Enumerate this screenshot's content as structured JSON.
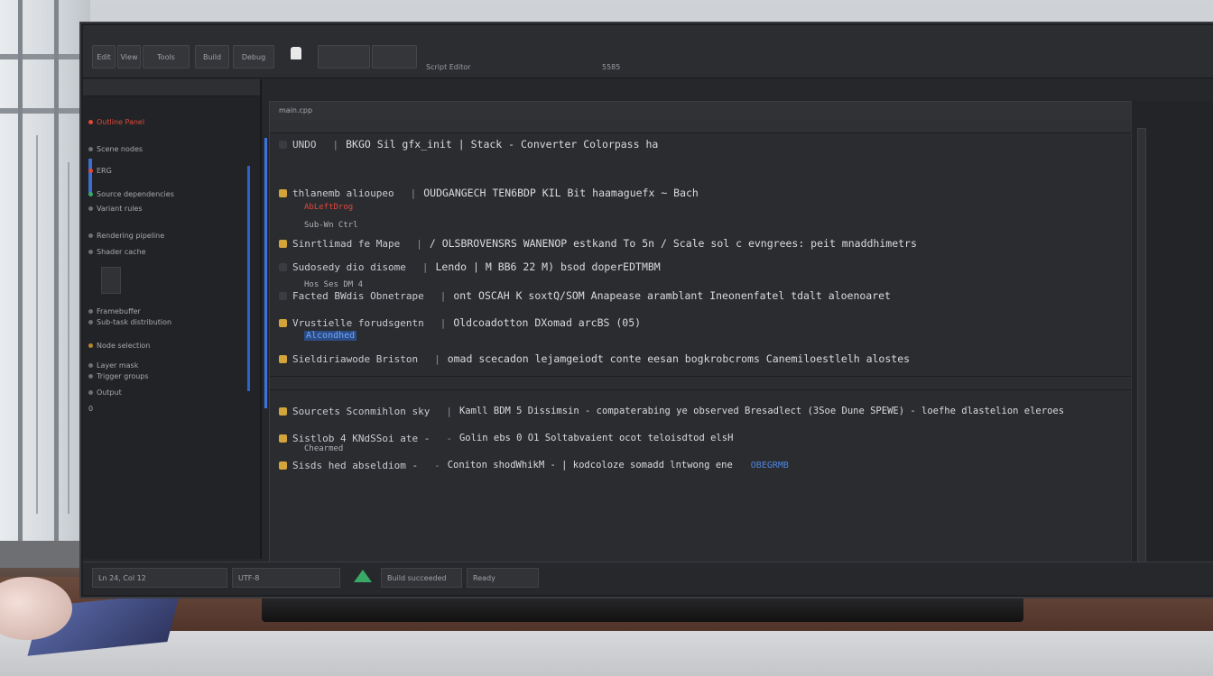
{
  "toolbar": {
    "title": "Script Editor",
    "status": "5585",
    "buttons": [
      "Edit",
      "View",
      "Tools",
      "Build",
      "Debug"
    ]
  },
  "left_panel": {
    "rows": [
      {
        "text": "Outline Panel",
        "color": "#e0483c"
      },
      {
        "text": "Scene nodes",
        "color": "#aeb1b6"
      },
      {
        "text": "ERG",
        "color": "#aeb1b6"
      },
      {
        "text": "Source dependencies",
        "color": "#aeb1b6"
      },
      {
        "text": "Variant rules",
        "color": "#aeb1b6"
      },
      {
        "text": "Rendering pipeline",
        "color": "#aeb1b6"
      },
      {
        "text": "Shader cache",
        "color": "#aeb1b6"
      },
      {
        "text": "Framebuffer",
        "color": "#aeb1b6"
      },
      {
        "text": "Sub-task distribution",
        "color": "#aeb1b6"
      },
      {
        "text": "Node selection",
        "color": "#aeb1b6"
      },
      {
        "text": "Layer mask",
        "color": "#aeb1b6"
      },
      {
        "text": "Trigger groups",
        "color": "#aeb1b6"
      },
      {
        "text": "Output",
        "color": "#aeb1b6"
      },
      {
        "text": "0",
        "color": "#aeb1b6"
      }
    ]
  },
  "editor": {
    "tab_label": "main.cpp",
    "lines": [
      {
        "left": "UNDO",
        "main": "BKGO Sil gfx_init | Stack - Converter Colorpass ha"
      },
      {
        "left": "thlanemb alioupeo",
        "main": "OUDGANGECH TEN6BDP KIL Bit haamaguefx ~ Bach"
      },
      {
        "left": "Sinrtlimad fe Mape",
        "main": "/ OLSBROVENSRS WANENOP estkand To 5n / Scale sol c evngrees: peit mnaddhimetrs"
      },
      {
        "left": "Sudosedy dio disome",
        "main": "Lendo | M BB6 22 M) bsod doperEDTMBM"
      },
      {
        "left": "Facted BWdis Obnetrape",
        "main": "ont OSCAH K soxtQ/SOM Anapease aramblant Ineonenfatel tdalt aloenoaret"
      },
      {
        "left": "Vrustielle forudsgentn",
        "main": "Oldcoadotton DXomad arcBS (05)"
      },
      {
        "left": "Sieldiriawode Briston",
        "main": "omad scecadon lejamgeiodt conte eesan bogkrobcroms Canemiloestlelh alostes"
      }
    ],
    "sub_lines": [
      "AbLeftDrog",
      "Sub-Wn Ctrl",
      "Hos Ses DM 4",
      "Alcondhed",
      "Chearmed"
    ],
    "lower_lines": [
      {
        "left": "Sourcets Sconmihlon sky",
        "main": "Kamll BDM 5 Dissimsin - compaterabing ye observed Bresadlect (3Soe Dune SPEWE) - loefhe dlastelion eleroes"
      },
      {
        "left": "Sistlob 4 KNdSSoi ate -",
        "main": "Golin ebs 0 O1 Soltabvaient ocot teloisdtod elsH"
      },
      {
        "left": "Sisds hed abseldiom -",
        "main": "Coniton shodWhikM - | kodcoloze somadd lntwong ene",
        "extra": "OBEGRMB"
      }
    ]
  },
  "statusbar": {
    "segments": [
      "Ln 24, Col 12",
      "UTF-8",
      "Build succeeded",
      "Ready"
    ]
  }
}
